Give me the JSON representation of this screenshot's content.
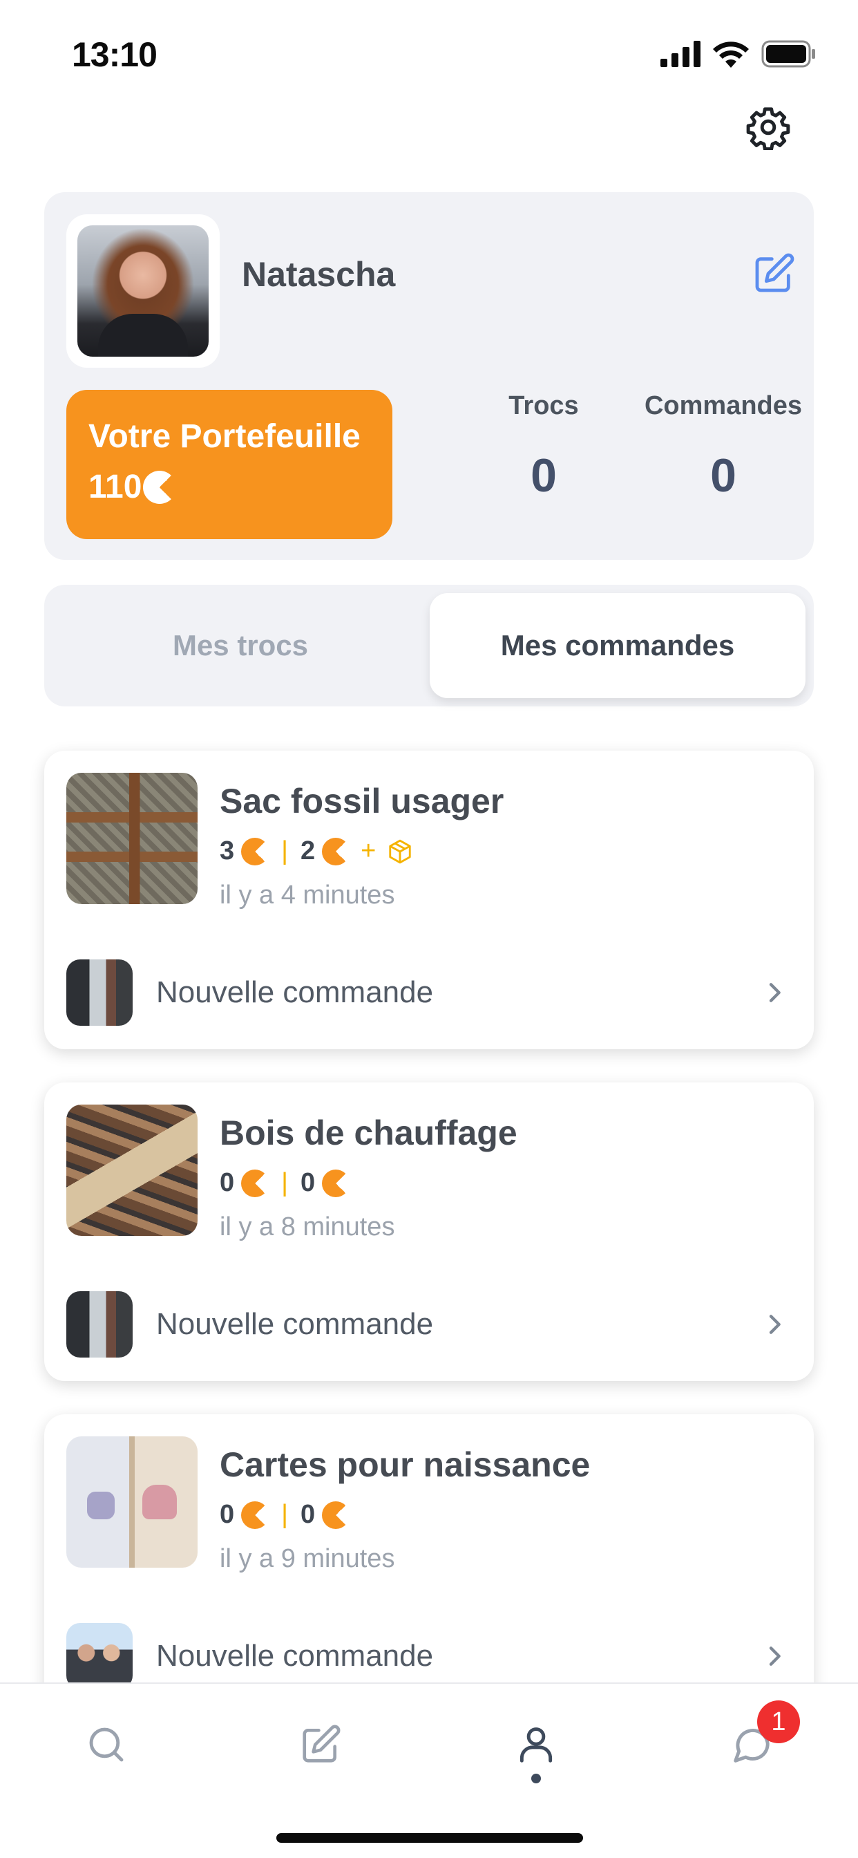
{
  "status_bar": {
    "time": "13:10"
  },
  "profile": {
    "name": "Natascha",
    "wallet_title": "Votre Portefeuille",
    "wallet_amount": "110",
    "stats": [
      {
        "label": "Trocs",
        "value": "0"
      },
      {
        "label": "Commandes",
        "value": "0"
      }
    ]
  },
  "tabs": [
    {
      "label": "Mes trocs",
      "active": false
    },
    {
      "label": "Mes commandes",
      "active": true
    }
  ],
  "orders": [
    {
      "title": "Sac fossil usager",
      "price_a": "3",
      "price_b": "2",
      "shipping_icon": "box-icon",
      "time": "il y a 4 minutes",
      "status": "Nouvelle commande"
    },
    {
      "title": "Bois de chauffage",
      "price_a": "0",
      "price_b": "0",
      "time": "il y a 8 minutes",
      "status": "Nouvelle commande"
    },
    {
      "title": "Cartes pour naissance",
      "price_a": "0",
      "price_b": "0",
      "time": "il y a 9 minutes",
      "status": "Nouvelle commande"
    }
  ],
  "tabbar": {
    "items": [
      "search-icon",
      "edit-icon",
      "profile-icon",
      "chat-icon"
    ],
    "active_index": 2,
    "chat_badge": "1"
  },
  "colors": {
    "accent": "#f7931e",
    "coin_yellow": "#f5b301",
    "badge": "#ef2f2f",
    "edit_blue": "#5b8def"
  }
}
